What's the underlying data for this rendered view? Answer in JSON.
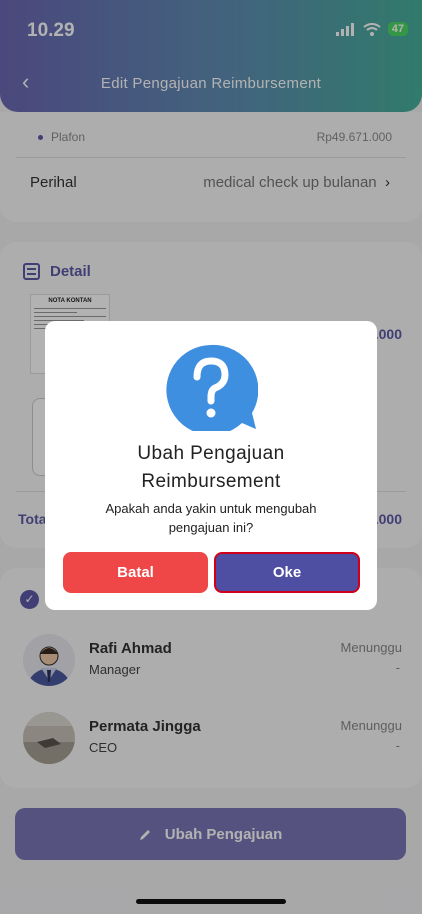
{
  "status_bar": {
    "time": "10.29",
    "battery": "47"
  },
  "header": {
    "back": "‹",
    "title": "Edit  Pengajuan Reimbursement"
  },
  "summary": {
    "plafon_label": "Plafon",
    "plafon_value": "Rp49.671.000",
    "perihal_label": "Perihal",
    "perihal_value": "medical check up bulanan",
    "perihal_chevron": "›"
  },
  "detail": {
    "title": "Detail",
    "receipt_title": "NOTA KONTAN",
    "amount_partial": ".000",
    "total_label_partial": "Tota",
    "total_amount_partial": ".000"
  },
  "approvers": [
    {
      "name": "Rafi Ahmad",
      "role": "Manager",
      "status": "Menunggu",
      "date": "-"
    },
    {
      "name": "Permata Jingga",
      "role": "CEO",
      "status": "Menunggu",
      "date": "-"
    }
  ],
  "bottom_button": {
    "label": "Ubah Pengajuan",
    "icon": "pencil-icon"
  },
  "dialog": {
    "icon": "question-bubble-icon",
    "title_line1": "Ubah Pengajuan",
    "title_line2": "Reimbursement",
    "message_line1": "Apakah anda yakin untuk mengubah",
    "message_line2": "pengajuan ini?",
    "cancel_label": "Batal",
    "ok_label": "Oke"
  },
  "colors": {
    "primary": "#5c5aa6",
    "danger": "#ef4747",
    "confirm": "#4e4ea3",
    "icon_blue": "#3f8fe0"
  }
}
